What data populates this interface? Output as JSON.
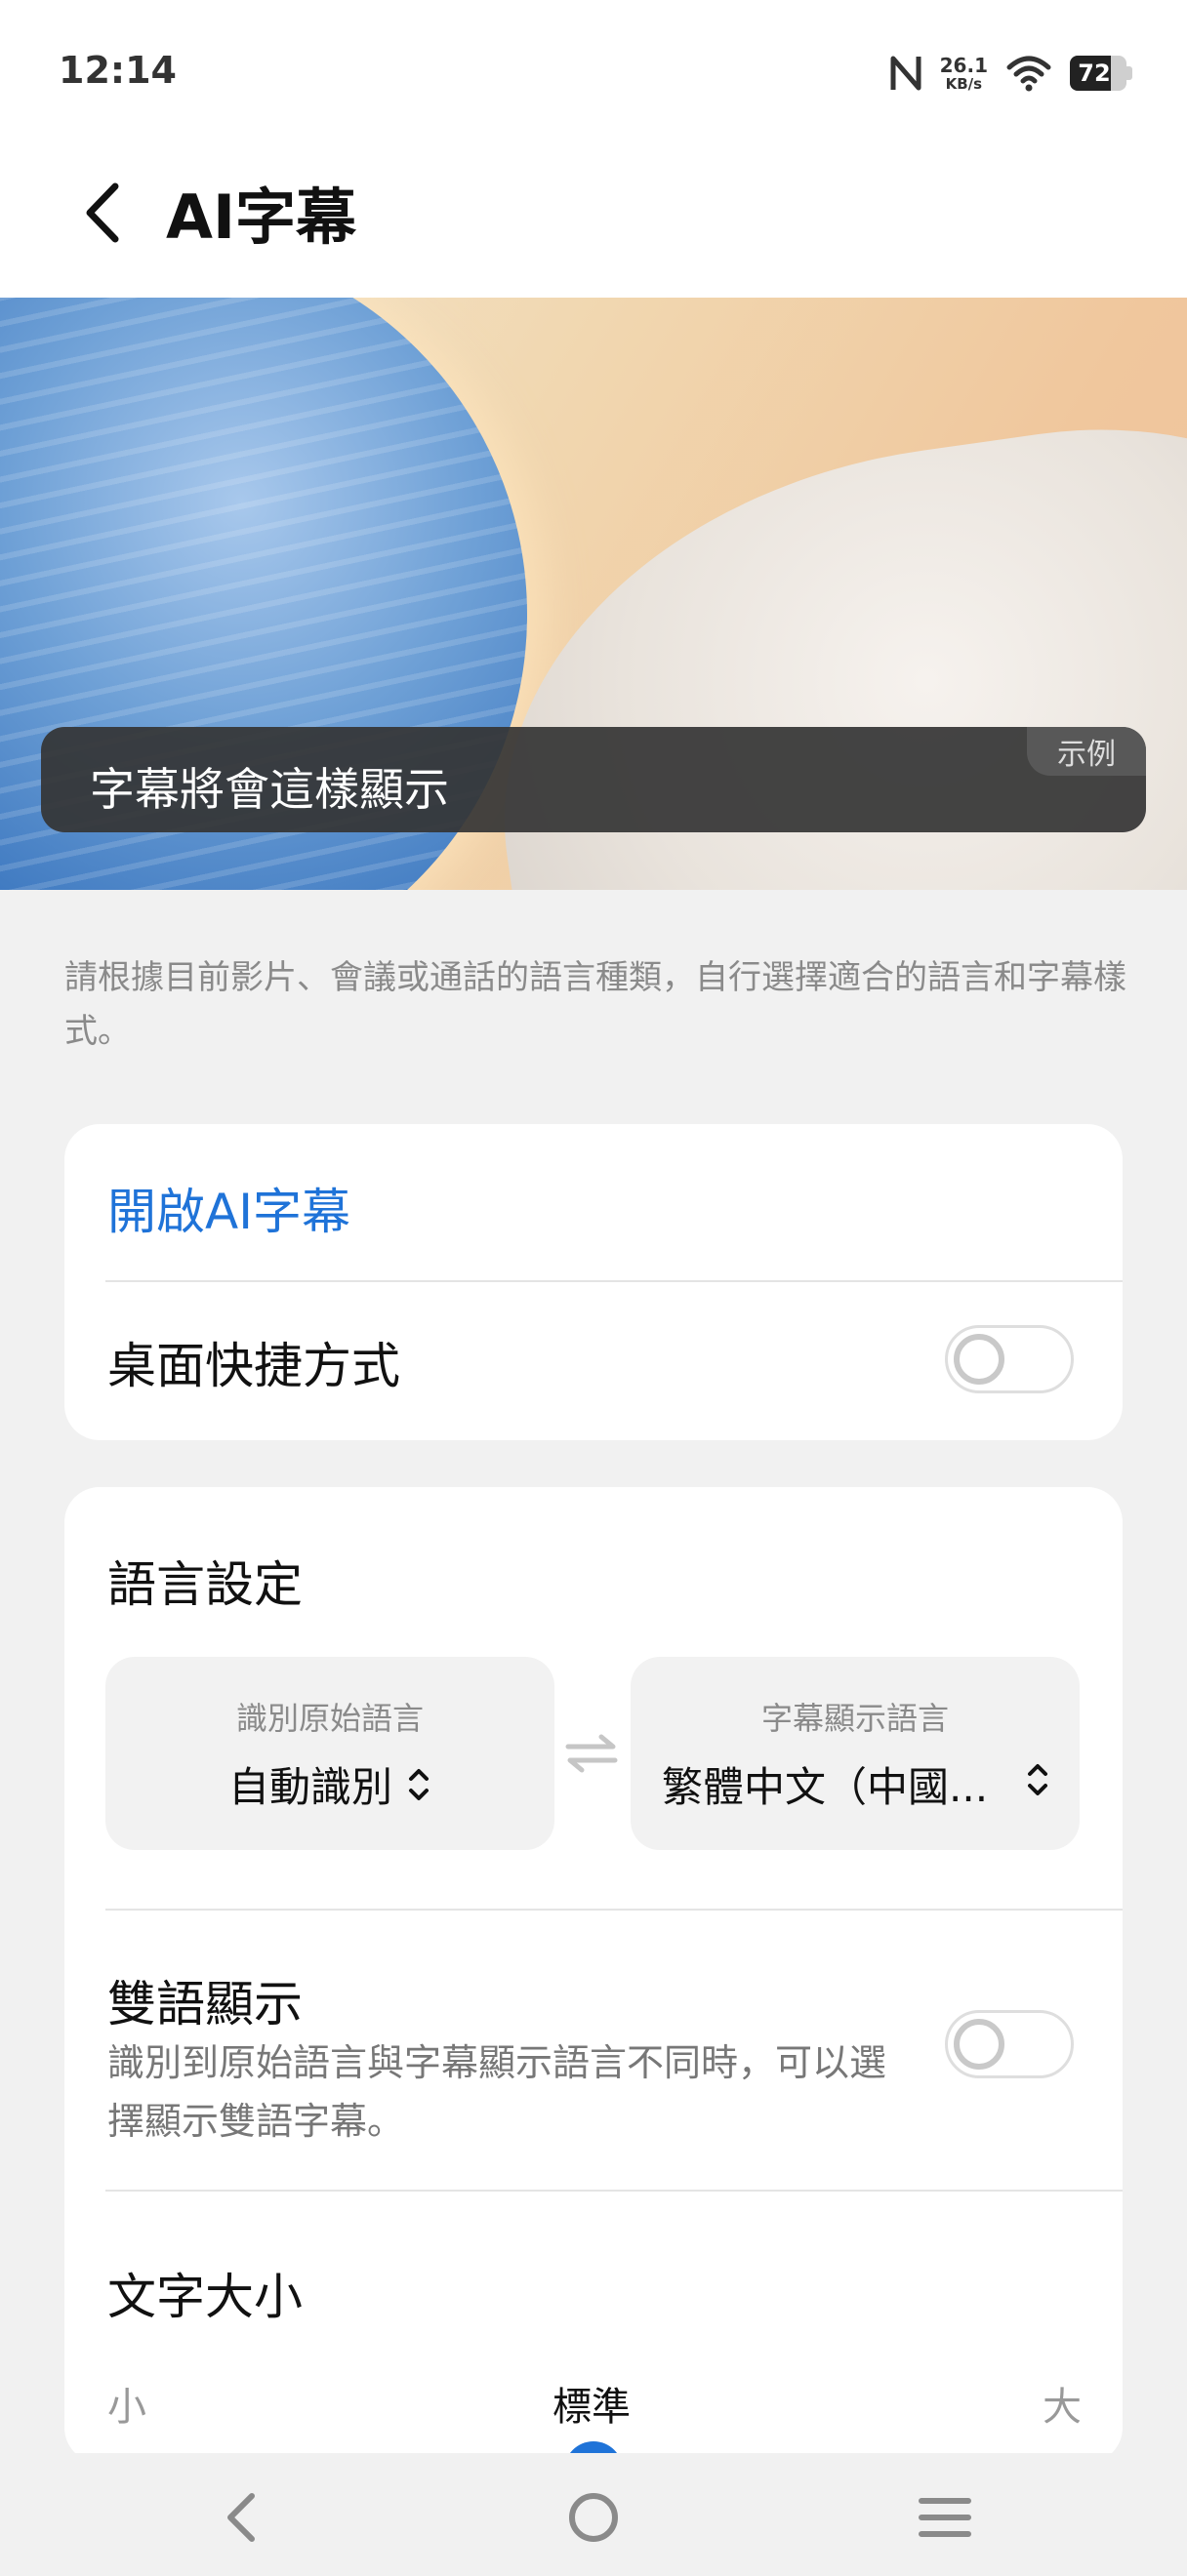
{
  "status_bar": {
    "time": "12:14",
    "net_speed_value": "26.1",
    "net_speed_unit": "KB/s",
    "battery_level": "72",
    "battery_fraction": 0.72,
    "icons": [
      "nfc-icon",
      "wifi-icon",
      "battery-icon"
    ]
  },
  "header": {
    "title": "AI字幕",
    "back_icon": "chevron-left-icon"
  },
  "preview": {
    "subtitle_text": "字幕將會這樣顯示",
    "badge": "示例"
  },
  "description": "請根據目前影片、會議或通話的語言種類，自行選擇適合的語言和字幕樣式。",
  "card_main": {
    "open_label": "開啟AI字幕",
    "shortcut_label": "桌面快捷方式",
    "shortcut_enabled": false
  },
  "language_settings": {
    "title": "語言設定",
    "source_caption": "識別原始語言",
    "source_value": "自動識別",
    "target_caption": "字幕顯示語言",
    "target_value": "繁體中文（中國...",
    "swap_icon": "swap-arrows-icon",
    "bilingual_title": "雙語顯示",
    "bilingual_desc": "識別到原始語言與字幕顯示語言不同時，可以選擇顯示雙語字幕。",
    "bilingual_enabled": false,
    "font_size_title": "文字大小",
    "size_small": "小",
    "size_standard": "標準",
    "size_large": "大"
  },
  "nav_bar": {
    "icons": [
      "nav-back-icon",
      "nav-home-icon",
      "nav-menu-icon"
    ]
  },
  "colors": {
    "accent": "#1f73d8",
    "background": "#f1f1f1"
  }
}
